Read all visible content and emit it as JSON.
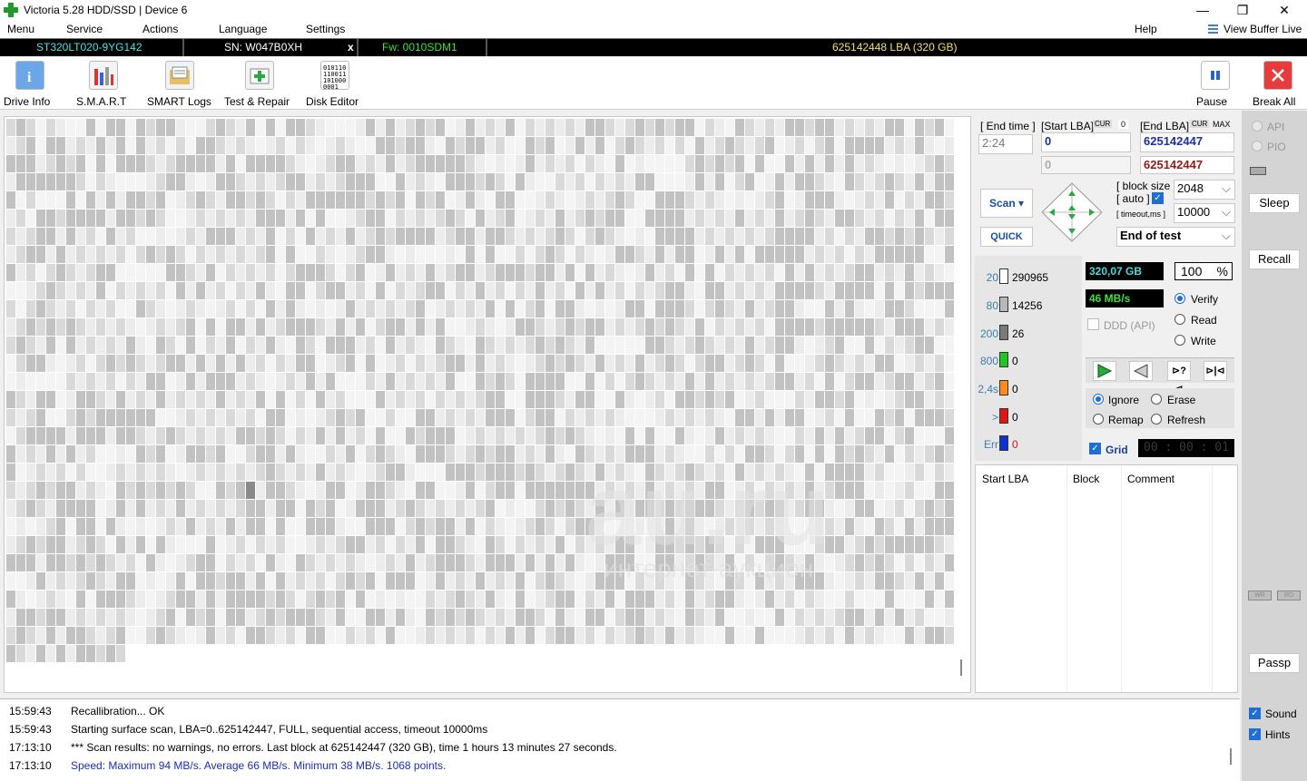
{
  "window": {
    "title": "Victoria 5.28 HDD/SSD | Device 6",
    "minimize": "—",
    "maximize": "❐",
    "close": "✕"
  },
  "menu": {
    "items": [
      "Menu",
      "Service",
      "Actions",
      "Language",
      "Settings"
    ],
    "help": "Help",
    "view_buffer": "View Buffer Live"
  },
  "drive": {
    "model": "ST320LT020-9YG142",
    "serial": "SN: W047B0XH",
    "eject": "x",
    "firmware": "Fw: 0010SDM1",
    "capacity": "625142448 LBA (320 GB)"
  },
  "toolbar": {
    "buttons": [
      "Drive Info",
      "S.M.A.R.T",
      "SMART Logs",
      "Test & Repair",
      "Disk Editor"
    ],
    "pause": "Pause",
    "break_all": "Break All"
  },
  "scan_panel": {
    "end_time_label": "[ End time ]",
    "start_lba_label": "[Start LBA]",
    "cur_label": "CUR",
    "start_cur": "0",
    "end_lba_label": "[End LBA]",
    "max_label": "MAX",
    "end_time_value": "2:24",
    "start_lba_value": "0",
    "start_lba_current": "0",
    "end_lba_value": "625142447",
    "end_lba_current": "625142447",
    "scan_button": "Scan",
    "quick_button": "QUICK",
    "block_size_label": "[ block size ]",
    "auto_label": "[ auto ]",
    "block_size_value": "2048",
    "timeout_label": "[ timeout,ms ]",
    "timeout_value": "10000",
    "end_action": "End of test"
  },
  "histogram": [
    {
      "label": "20",
      "count": "290965",
      "color": "#ffffff"
    },
    {
      "label": "80",
      "count": "14256",
      "color": "#b9b9b9"
    },
    {
      "label": "200",
      "count": "26",
      "color": "#7a7a7a"
    },
    {
      "label": "800",
      "count": "0",
      "color": "#22c522"
    },
    {
      "label": "2,4s",
      "count": "0",
      "color": "#ff8a1e"
    },
    {
      "label": ">",
      "count": "0",
      "color": "#e01616"
    },
    {
      "label": "Err",
      "count": "0",
      "color": "#1030d0"
    }
  ],
  "status": {
    "size_done": "320,07 GB",
    "percent": "100",
    "percent_sign": "%",
    "speed": "46 MB/s",
    "ddd_label": "DDD (API)",
    "modes": [
      "Verify",
      "Read",
      "Write"
    ],
    "selected_mode": "Verify",
    "actions": [
      "Ignore",
      "Erase",
      "Remap",
      "Refresh"
    ],
    "selected_action": "Ignore",
    "grid_label": "Grid",
    "grid_time": "00 : 00 : 01"
  },
  "defect_table": {
    "headers": [
      "Start LBA",
      "Block",
      "Comment"
    ]
  },
  "side": {
    "api": "API",
    "pio": "PIO",
    "sleep": "Sleep",
    "recall": "Recall",
    "wr": "WR",
    "rd": "RD",
    "passp": "Passp",
    "sound": "Sound",
    "hints": "Hints"
  },
  "log": [
    {
      "time": "15:59:43",
      "msg": "Recallibration... OK",
      "color": "#000000"
    },
    {
      "time": "15:59:43",
      "msg": "Starting surface scan, LBA=0..625142447, FULL, sequential access, timeout 10000ms",
      "color": "#000000"
    },
    {
      "time": "17:13:10",
      "msg": "*** Scan results: no warnings, no errors. Last block at 625142447 (320 GB), time 1 hours 13 minutes 27 seconds.",
      "color": "#000000"
    },
    {
      "time": "17:13:10",
      "msg": "Speed: Maximum 94 MB/s. Average 66 MB/s. Minimum 38 MB/s. 1068 points.",
      "color": "#1a2fb0"
    }
  ],
  "watermark": {
    "main": "au.ru",
    "sub": "интернет-аукцион"
  }
}
